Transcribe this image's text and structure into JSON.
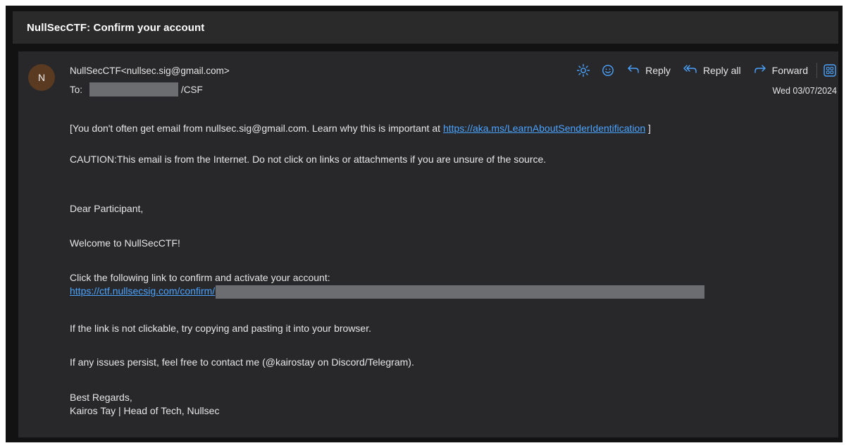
{
  "subject": "NullSecCTF: Confirm your account",
  "sender": {
    "avatar_initial": "N",
    "display": "NullSecCTF<nullsec.sig@gmail.com>",
    "to_label": "To:",
    "to_suffix": "/CSF",
    "date": "Wed 03/07/2024"
  },
  "actions": {
    "reply": "Reply",
    "reply_all": "Reply all",
    "forward": "Forward"
  },
  "body": {
    "notice_prefix": "[You don't often get email from nullsec.sig@gmail.com. Learn why this is important at",
    "notice_link": "https://aka.ms/LearnAboutSenderIdentification",
    "notice_suffix": "]",
    "caution": "CAUTION:This email is from the Internet. Do not click on links or attachments if you are unsure of the source.",
    "greeting": "Dear Participant,",
    "welcome": "Welcome to NullSecCTF!",
    "click_instruction": "Click the following link to confirm and activate your account:",
    "confirm_link": "https://ctf.nullsecsig.com/confirm/",
    "not_clickable": "If the link is not clickable, try copying and pasting it into your browser.",
    "issues": "If any issues persist, feel free to contact me (@kairostay on Discord/Telegram).",
    "sign_off": "Best Regards,",
    "signature": "Kairos Tay | Head of Tech, Nullsec"
  },
  "colors": {
    "accent": "#4aa3ff",
    "card_bg": "#28282a",
    "header_bg": "#2a2a2b",
    "avatar_bg": "#5a3a20",
    "redaction": "#6b6d70"
  }
}
